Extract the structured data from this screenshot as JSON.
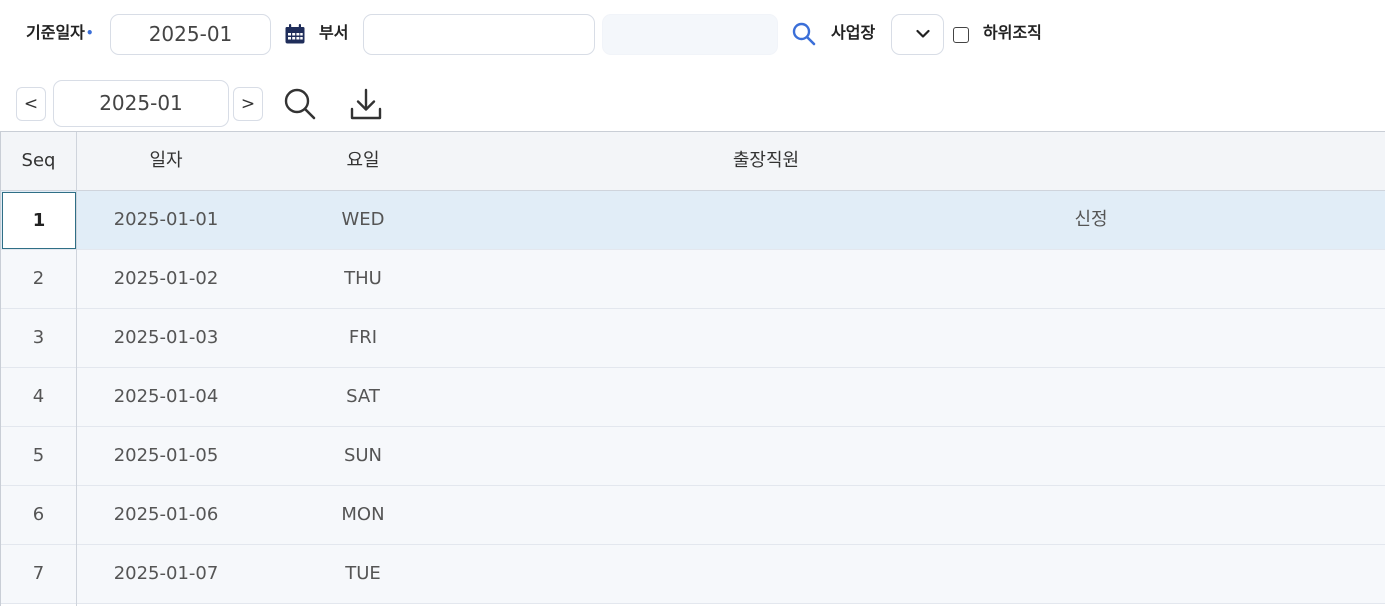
{
  "filter": {
    "base_date_label": "기준일자",
    "required_mark": "•",
    "base_date_value": "2025-01",
    "dept_label": "부서",
    "dept_value": "",
    "dept_name_value": "",
    "site_label": "사업장",
    "site_value": "",
    "include_sub_label": "하위조직",
    "include_sub_checked": false
  },
  "nav": {
    "prev_label": "<",
    "month_value": "2025-01",
    "next_label": ">"
  },
  "grid": {
    "columns": [
      "Seq",
      "일자",
      "요일",
      "출장직원"
    ],
    "selected_row": 0,
    "rows": [
      {
        "seq": "1",
        "date": "2025-01-01",
        "day": "WED",
        "status": "신정"
      },
      {
        "seq": "2",
        "date": "2025-01-02",
        "day": "THU",
        "status": ""
      },
      {
        "seq": "3",
        "date": "2025-01-03",
        "day": "FRI",
        "status": ""
      },
      {
        "seq": "4",
        "date": "2025-01-04",
        "day": "SAT",
        "status": ""
      },
      {
        "seq": "5",
        "date": "2025-01-05",
        "day": "SUN",
        "status": ""
      },
      {
        "seq": "6",
        "date": "2025-01-06",
        "day": "MON",
        "status": ""
      },
      {
        "seq": "7",
        "date": "2025-01-07",
        "day": "TUE",
        "status": ""
      }
    ]
  },
  "icons": {
    "calendar": "calendar-icon",
    "dept_search": "search-icon",
    "site_dropdown": "chevron-down-icon",
    "nav_search": "search-icon",
    "download": "download-icon"
  },
  "colors": {
    "accent": "#3b6fd8",
    "selected_row": "#e1edf7",
    "active_cell_border": "#2f6f86",
    "row_bg": "#f6f8fb",
    "header_bg": "#f3f5f8"
  }
}
